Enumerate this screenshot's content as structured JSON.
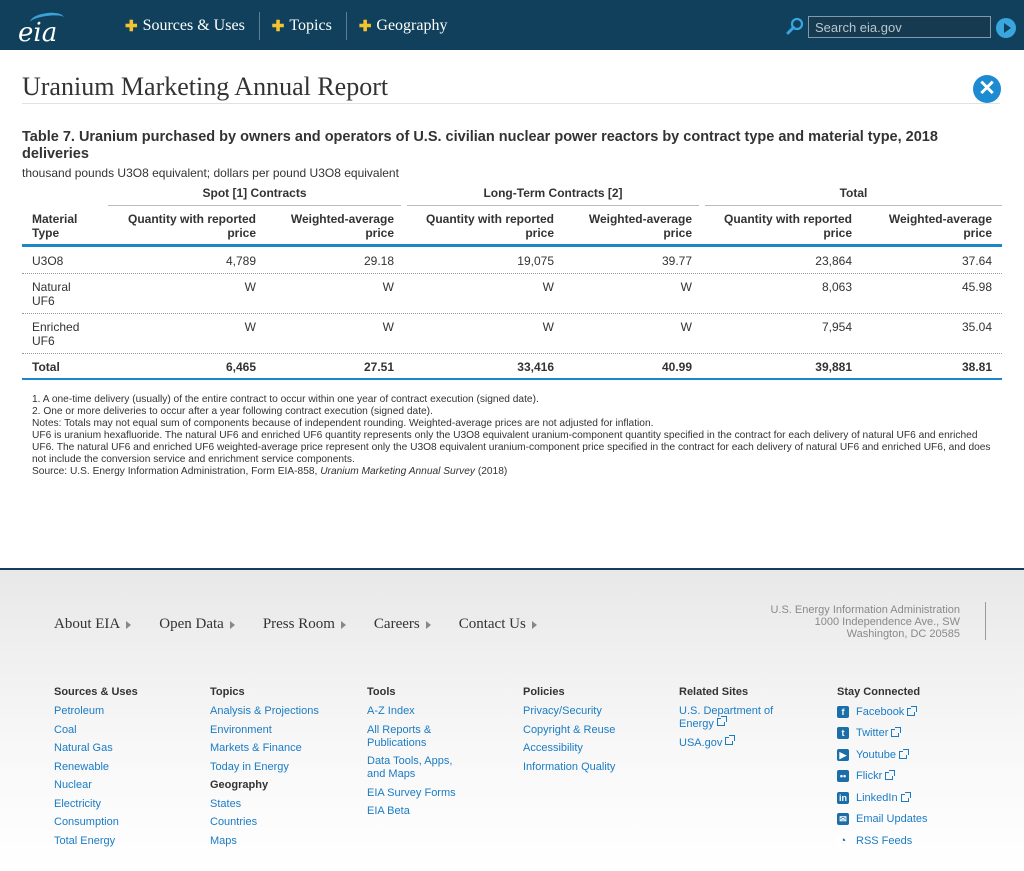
{
  "header": {
    "logo_text": "eia",
    "nav": [
      "Sources & Uses",
      "Topics",
      "Geography"
    ],
    "search_placeholder": "Search eia.gov"
  },
  "page": {
    "title": "Uranium Marketing Annual Report",
    "table_title": "Table 7. Uranium purchased by owners and operators of U.S. civilian nuclear power reactors by contract type and material type, 2018 deliveries",
    "table_subtitle": "thousand pounds U3O8 equivalent; dollars per pound U3O8 equivalent"
  },
  "table": {
    "groups": [
      "Spot [1] Contracts",
      "Long-Term Contracts [2]",
      "Total"
    ],
    "col_material": "Material Type",
    "col_qty": "Quantity with reported price",
    "col_price": "Weighted-average price",
    "rows": [
      {
        "type": "U3O8",
        "cells": [
          "4,789",
          "29.18",
          "19,075",
          "39.77",
          "23,864",
          "37.64"
        ]
      },
      {
        "type": "Natural UF6",
        "cells": [
          "W",
          "W",
          "W",
          "W",
          "8,063",
          "45.98"
        ]
      },
      {
        "type": "Enriched UF6",
        "cells": [
          "W",
          "W",
          "W",
          "W",
          "7,954",
          "35.04"
        ]
      },
      {
        "type": "Total",
        "cells": [
          "6,465",
          "27.51",
          "33,416",
          "40.99",
          "39,881",
          "38.81"
        ]
      }
    ]
  },
  "notes": {
    "n1": "1. A one-time delivery (usually) of the entire contract to occur within one year of contract execution (signed date).",
    "n2": "2. One or more deliveries to occur after a year following contract execution (signed date).",
    "n3": "Notes: Totals may not equal sum of components because of independent rounding. Weighted-average prices are not adjusted for inflation.",
    "n4": "UF6 is uranium hexafluoride. The natural UF6 and enriched UF6 quantity represents only the U3O8 equivalent uranium-component quantity specified in the contract for each delivery of natural UF6 and enriched UF6. The natural UF6 and enriched UF6 weighted-average price represent only the U3O8 equivalent uranium-component price specified in the contract for each delivery of natural UF6 and enriched UF6, and does not include the conversion service and enrichment service components.",
    "source_prefix": "Source: U.S. Energy Information Administration, Form EIA-858, ",
    "source_title": "Uranium Marketing Annual Survey",
    "source_suffix": " (2018)"
  },
  "footer": {
    "nav": [
      "About EIA",
      "Open Data",
      "Press Room",
      "Careers",
      "Contact Us"
    ],
    "address": [
      "U.S. Energy Information Administration",
      "1000 Independence Ave., SW",
      "Washington, DC 20585"
    ],
    "columns": {
      "sources_uses": {
        "title": "Sources & Uses",
        "links": [
          "Petroleum",
          "Coal",
          "Natural Gas",
          "Renewable",
          "Nuclear",
          "Electricity",
          "Consumption",
          "Total Energy"
        ]
      },
      "topics": {
        "title": "Topics",
        "links": [
          "Analysis & Projections",
          "Environment",
          "Markets & Finance",
          "Today in Energy"
        ],
        "sub_title": "Geography",
        "sub_links": [
          "States",
          "Countries",
          "Maps"
        ]
      },
      "tools": {
        "title": "Tools",
        "links": [
          "A-Z Index",
          "All Reports & Publications",
          "Data Tools, Apps, and Maps",
          "EIA Survey Forms",
          "EIA Beta"
        ]
      },
      "policies": {
        "title": "Policies",
        "links": [
          "Privacy/Security",
          "Copyright & Reuse",
          "Accessibility",
          "Information Quality"
        ]
      },
      "related": {
        "title": "Related Sites",
        "links": [
          "U.S. Department of Energy",
          "USA.gov"
        ]
      },
      "stay": {
        "title": "Stay Connected",
        "links": [
          "Facebook",
          "Twitter",
          "Youtube",
          "Flickr",
          "LinkedIn",
          "Email Updates",
          "RSS Feeds"
        ]
      }
    }
  }
}
